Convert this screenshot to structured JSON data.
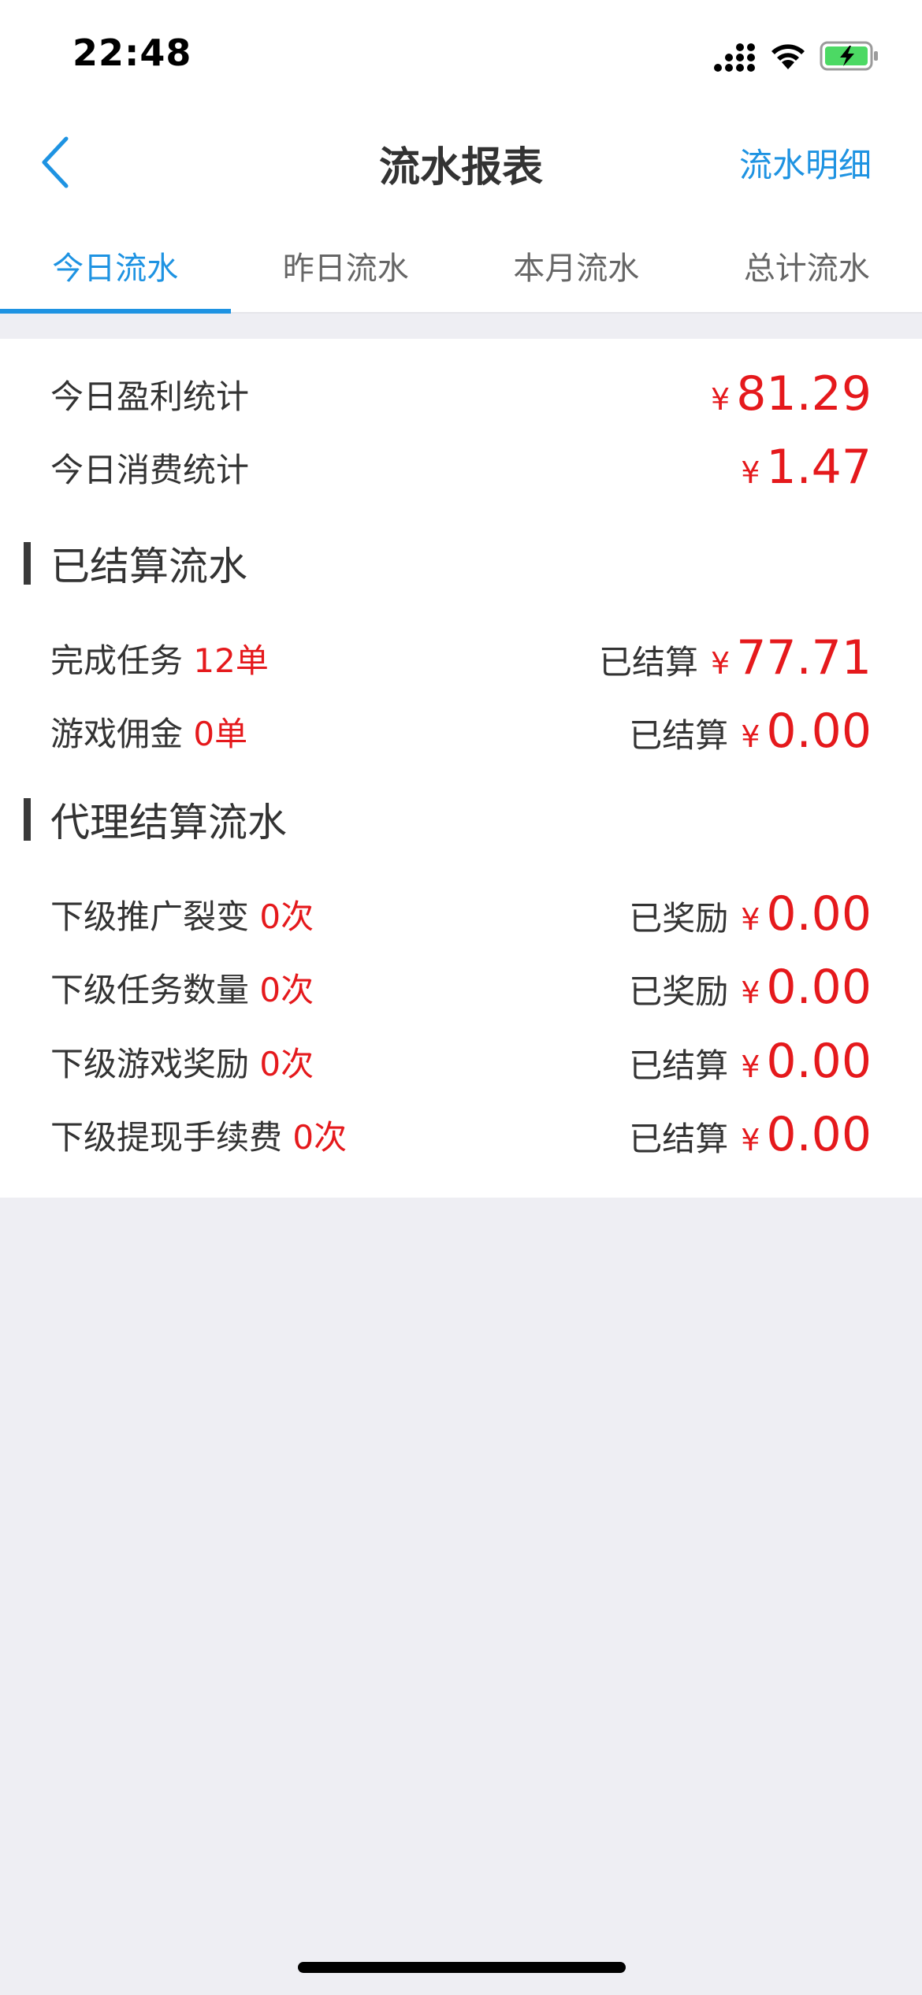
{
  "status_bar": {
    "time": "22:48"
  },
  "nav": {
    "title": "流水报表",
    "action": "流水明细"
  },
  "tabs": [
    {
      "label": "今日流水",
      "active": true
    },
    {
      "label": "昨日流水",
      "active": false
    },
    {
      "label": "本月流水",
      "active": false
    },
    {
      "label": "总计流水",
      "active": false
    }
  ],
  "summary": [
    {
      "label": "今日盈利统计",
      "currency": "¥",
      "amount": "81.29"
    },
    {
      "label": "今日消费统计",
      "currency": "¥",
      "amount": "1.47"
    }
  ],
  "settled_section": {
    "title": "已结算流水",
    "rows": [
      {
        "label": "完成任务",
        "count": "12单",
        "status": "已结算",
        "currency": "¥",
        "amount": "77.71"
      },
      {
        "label": "游戏佣金",
        "count": "0单",
        "status": "已结算",
        "currency": "¥",
        "amount": "0.00"
      }
    ]
  },
  "agent_section": {
    "title": "代理结算流水",
    "rows": [
      {
        "label": "下级推广裂变",
        "count": "0次",
        "status": "已奖励",
        "currency": "¥",
        "amount": "0.00"
      },
      {
        "label": "下级任务数量",
        "count": "0次",
        "status": "已奖励",
        "currency": "¥",
        "amount": "0.00"
      },
      {
        "label": "下级游戏奖励",
        "count": "0次",
        "status": "已结算",
        "currency": "¥",
        "amount": "0.00"
      },
      {
        "label": "下级提现手续费",
        "count": "0次",
        "status": "已结算",
        "currency": "¥",
        "amount": "0.00"
      }
    ]
  },
  "colors": {
    "accent": "#1E93E2",
    "amount_red": "#E5191C",
    "background": "#EEEEF3",
    "battery_green": "#4CD964"
  }
}
